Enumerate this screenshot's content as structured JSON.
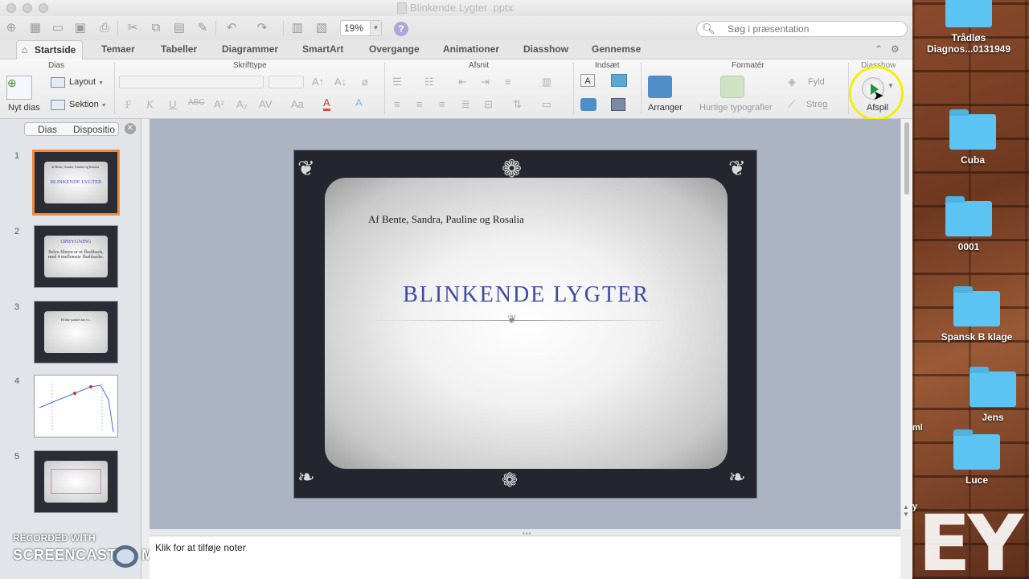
{
  "window": {
    "title": "Blinkende Lygter .pptx"
  },
  "toolbar": {
    "zoom": "19%",
    "help": "?"
  },
  "search": {
    "placeholder": "Søg i præsentation"
  },
  "tabs": [
    "Startside",
    "Temaer",
    "Tabeller",
    "Diagrammer",
    "SmartArt",
    "Overgange",
    "Animationer",
    "Diasshow",
    "Gennemse"
  ],
  "ribbon": {
    "groups": {
      "dias": "Dias",
      "skrifttype": "Skrifttype",
      "afsnit": "Afsnit",
      "indsaet": "Indsæt",
      "formater": "Formatér",
      "diasshow": "Diasshow"
    },
    "new_slide": "Nyt dias",
    "layout": "Layout",
    "section": "Sektion",
    "font_bold": "F",
    "font_italic": "K",
    "arrange": "Arranger",
    "quick_styles": "Hurtige typografier",
    "fill": "Fyld",
    "line": "Streg",
    "play": "Afspil"
  },
  "panel": {
    "tab_slides": "Dias",
    "tab_outline": "Dispositio",
    "slides": [
      {
        "number": "1",
        "title": "BLINKENDE LYGTER",
        "text": "Af Bente, Sandra, Pauline og Rosalia"
      },
      {
        "number": "2",
        "title": "OPBYGNING",
        "text": "Selve filmen er et flashback, med 4 mellemste flashbacks."
      },
      {
        "number": "3",
        "title": "",
        "text": "Hvilke punkter har vi..."
      },
      {
        "number": "4",
        "title": "",
        "text": ""
      },
      {
        "number": "5",
        "title": "",
        "text": ""
      }
    ]
  },
  "slide": {
    "subtitle": "Af  Bente, Sandra, Pauline og Rosalia",
    "title": "BLINKENDE LYGTER"
  },
  "notes": {
    "placeholder": "Klik for at tilføje noter"
  },
  "watermark": {
    "line1": "RECORDED WITH",
    "line2": "SCREENCAST",
    "line3": "MATIC"
  },
  "desktop": {
    "items": [
      {
        "label": "Trådløs Diagnos...0131949"
      },
      {
        "label": "Cuba"
      },
      {
        "label": "0001"
      },
      {
        "label": "Spansk B klage"
      },
      {
        "label": "Jens"
      },
      {
        "label": "Luce"
      }
    ],
    "edge_labels": [
      "ml",
      "y"
    ],
    "logo": "EY"
  },
  "colors": {
    "accent_orange": "#ef8a3b",
    "title_blue": "#3e4aa0",
    "highlight_yellow": "#f5f000",
    "play_green": "#1c9a3a"
  }
}
